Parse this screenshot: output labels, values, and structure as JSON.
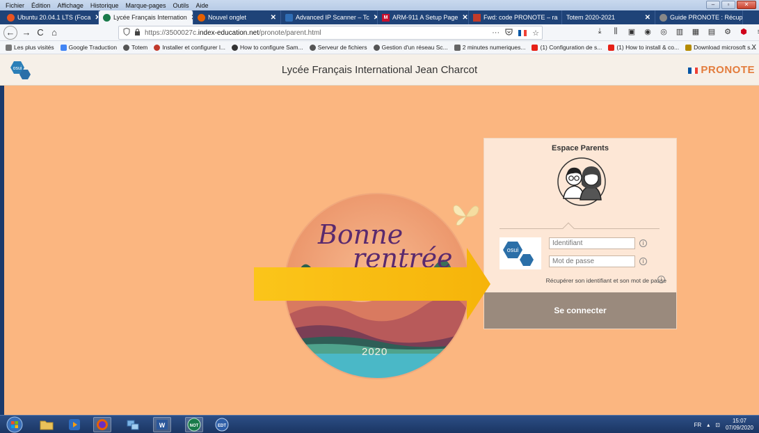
{
  "menu": [
    "Fichier",
    "Édition",
    "Affichage",
    "Historique",
    "Marque-pages",
    "Outils",
    "Aide"
  ],
  "window_controls": [
    "–",
    "▫",
    "✕"
  ],
  "tabs": [
    {
      "label": "Ubuntu 20.04.1 LTS (Foca",
      "icon": "ubuntu-icon",
      "color": "#e95420"
    },
    {
      "label": "Lycée Français Internation",
      "icon": "pronote-icon",
      "color": "#1a7a4a",
      "active": true
    },
    {
      "label": "Nouvel onglet",
      "icon": "firefox-icon",
      "color": "#e66000"
    },
    {
      "label": "Advanced IP Scanner – Tc",
      "icon": "scanner-icon",
      "color": "#2f6db5"
    },
    {
      "label": "ARM-911 A Setup Page",
      "icon": "m-icon",
      "color": "#c8102e"
    },
    {
      "label": "Fwd: code PRONOTE – ra",
      "icon": "mail-icon",
      "color": "#c23b2a"
    },
    {
      "label": "Totem 2020-2021",
      "icon": "",
      "color": ""
    },
    {
      "label": "Guide PRONOTE : Récupé",
      "icon": "guide-icon",
      "color": "#888888"
    }
  ],
  "tab_close": "✕",
  "nav": {
    "back": "←",
    "forward": "→",
    "reload": "C",
    "home": "⌂",
    "url_prefix": "https://3500027c.",
    "url_domain": "index-education.net",
    "url_path": "/pronote/parent.html",
    "more": "···",
    "star": "☆"
  },
  "bookmarks": [
    {
      "label": "Les plus visités",
      "color": "#777777"
    },
    {
      "label": "Google Traduction",
      "color": "#4285f4"
    },
    {
      "label": "Totem",
      "color": "#555555"
    },
    {
      "label": "Installer et configurer l...",
      "color": "#c0392b"
    },
    {
      "label": "How to configure Sam...",
      "color": "#333333"
    },
    {
      "label": "Serveur de fichiers",
      "color": "#555555"
    },
    {
      "label": "Gestion d'un réseau Sc...",
      "color": "#555555"
    },
    {
      "label": "2 minutes numeriques...",
      "color": "#666666"
    },
    {
      "label": "(1) Configuration de s...",
      "color": "#e62117"
    },
    {
      "label": "(1) How to install & co...",
      "color": "#e62117"
    },
    {
      "label": "Download microsoft s...",
      "color": "#b58b00"
    }
  ],
  "bookmarks_more": "X",
  "header": {
    "title": "Lycée Français International Jean Charcot",
    "osui_logo": "osui",
    "pronote_logo": "PRONOTE"
  },
  "illustration": {
    "line1": "Bonne",
    "line2": "rentrée",
    "year": "2020"
  },
  "login": {
    "title": "Espace Parents",
    "osui_logo": "osui",
    "username_placeholder": "Identifiant",
    "password_placeholder": "Mot de passe",
    "info": "i",
    "recover": "Récupérer son identifiant et son mot de passe",
    "connect": "Se connecter"
  },
  "taskbar": {
    "apps": [
      {
        "name": "explorer",
        "icon": "folder-icon"
      },
      {
        "name": "media",
        "icon": "media-player-icon"
      },
      {
        "name": "firefox",
        "icon": "firefox-icon",
        "selected": true
      },
      {
        "name": "network",
        "icon": "network-icon"
      },
      {
        "name": "word",
        "icon": "word-icon",
        "label": "W"
      },
      {
        "name": "not",
        "icon": "pronote-net-icon",
        "label": "NOT",
        "selected": true
      },
      {
        "name": "edt",
        "icon": "edt-icon",
        "label": "EDT"
      }
    ],
    "lang": "FR",
    "time": "15:07",
    "date": "07/09/2020"
  }
}
